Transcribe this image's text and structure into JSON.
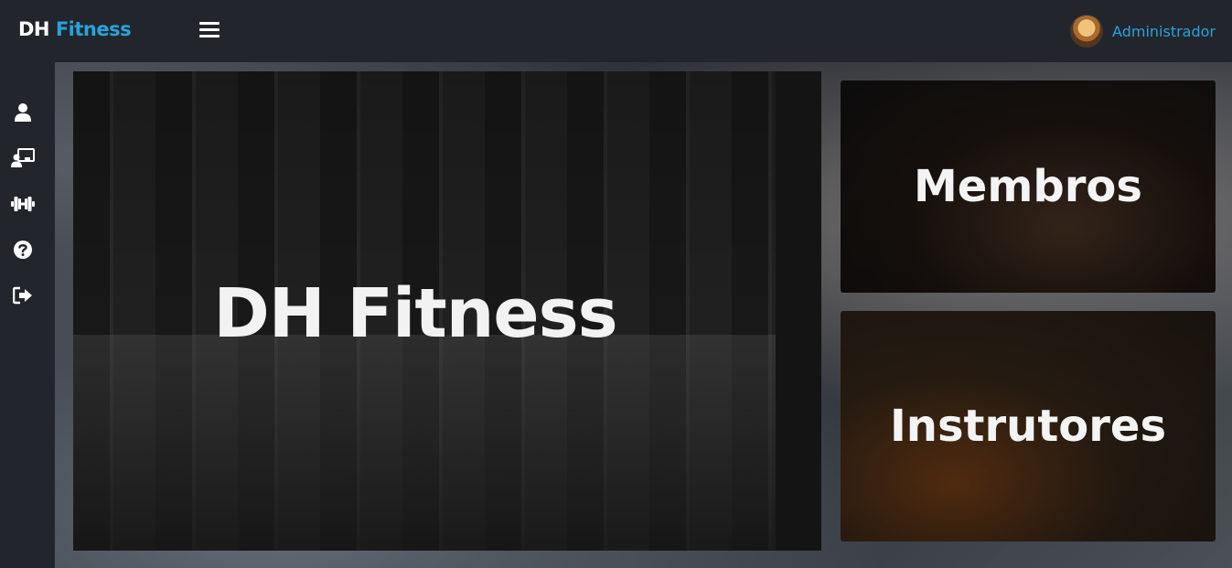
{
  "brand": {
    "part1": "DH",
    "part2": "Fitness",
    "accent_color": "#27a3dc"
  },
  "header": {
    "menu_icon": "hamburger-icon",
    "user_name": "Administrador",
    "avatar_icon": "user-avatar"
  },
  "sidebar": {
    "items": [
      {
        "icon": "user-icon"
      },
      {
        "icon": "chalkboard-teacher-icon"
      },
      {
        "icon": "dumbbell-icon"
      },
      {
        "icon": "question-circle-icon"
      },
      {
        "icon": "sign-out-icon"
      }
    ]
  },
  "main": {
    "hero_title": "DH Fitness",
    "cards": [
      {
        "title": "Membros"
      },
      {
        "title": "Instrutores"
      }
    ]
  }
}
